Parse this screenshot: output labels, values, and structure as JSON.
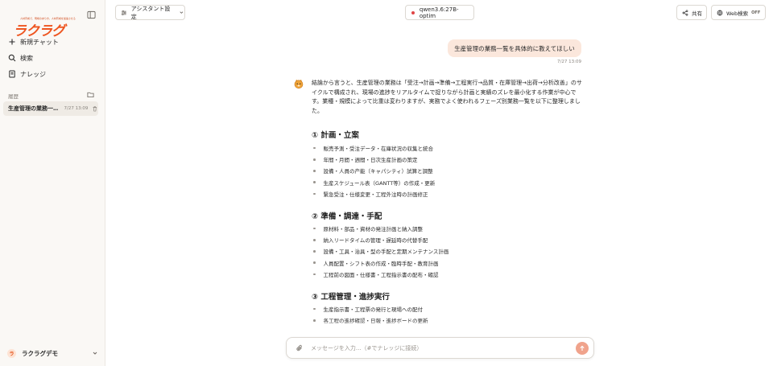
{
  "app": {
    "logo_tagline": "人材育成で、現場のあり方、人材育成を加速させる",
    "logo_text": "ラクラグ",
    "brand_color": "#ee5520"
  },
  "sidebar": {
    "nav": [
      {
        "icon": "plus-icon",
        "label": "新規チャット"
      },
      {
        "icon": "search-icon",
        "label": "検索"
      },
      {
        "icon": "book-icon",
        "label": "ナレッジ"
      }
    ],
    "history_label": "履歴",
    "history": [
      {
        "title": "生産管理の業務一…",
        "time": "7/27 13:09"
      }
    ],
    "user": {
      "avatar_letter": "ラ",
      "name": "ラクラグデモ"
    }
  },
  "topbar": {
    "assistant_label": "アシスタント設定",
    "model_name": "qwen3.6:27B-optim",
    "share_label": "共有",
    "web_search_label": "Web検索",
    "web_search_state": "OFF"
  },
  "conversation": {
    "user_message": "生産管理の業務一覧を具体的に教えてほしい",
    "user_time": "7/27 13:09",
    "answer_intro": "結論から言うと、生産管理の業務は「受注→計画→準備→工程実行→品質・在庫管理→出荷→分析改善」のサイクルで構成され、現場の進捗をリアルタイムで捉りながら計画と実績のズレを最小化する作業が中心です。業種・規模によって比重は変わりますが、実務でよく使われるフェーズ別業務一覧を以下に整理しました。",
    "sections": [
      {
        "title": "① 計画・立案",
        "items": [
          "販売予測・受注データ・在庫状況の収集と統合",
          "年間・月間・週間・日次生産計画の策定",
          "設備・人員の产能（キャパシティ）試算と調整",
          "生産スケジュール表（GANTT等）の作成・更新",
          "緊急受注・仕様変更・工程外注時の計画修正"
        ]
      },
      {
        "title": "② 準備・調達・手配",
        "items": [
          "原材料・部品・資材の発注計画と納入調整",
          "納入リードタイムの管理・遅延時の代替手配",
          "設備・工具・治具・型の手配と定期メンテナンス計画",
          "人員配置・シフト表の作成・臨時手配・教育計画",
          "工程前の図面・仕様書・工程指示書の配布・確認"
        ]
      },
      {
        "title": "③ 工程管理・進捗実行",
        "items": [
          "生産指示書・工程票の発行と現場への配付",
          "各工程の進捗確認・日報・進捗ボードの更新"
        ]
      }
    ]
  },
  "input": {
    "placeholder": "メッセージを入力...（#でナレッジに接続）",
    "value": ""
  }
}
